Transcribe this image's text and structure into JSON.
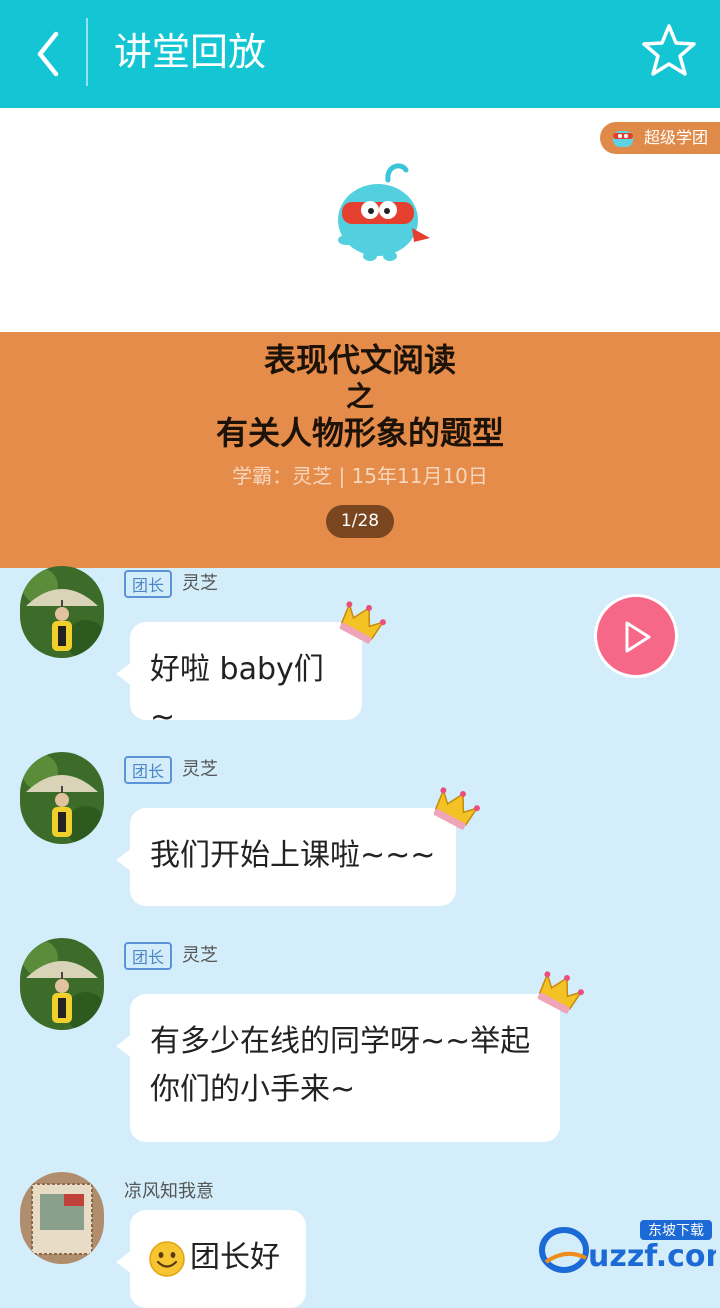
{
  "header": {
    "title": "讲堂回放"
  },
  "hero": {
    "badge": "超级学团",
    "lesson_line1": "表现代文阅读",
    "lesson_line2": "之",
    "lesson_line3": "有关人物形象的题型",
    "meta": "学霸：灵芝 | 15年11月10日",
    "page": "1/28"
  },
  "messages": [
    {
      "role": "团长",
      "name": "灵芝",
      "text": "好啦 baby们~"
    },
    {
      "role": "团长",
      "name": "灵芝",
      "text": "我们开始上课啦~~~"
    },
    {
      "role": "团长",
      "name": "灵芝",
      "text": "有多少在线的同学呀~~举起你们的小手来~"
    },
    {
      "name": "凉风知我意",
      "text": "团长好"
    }
  ],
  "watermark": {
    "text": "uzzf.com",
    "sub": "东坡下载"
  },
  "colors": {
    "header": "#14c6d4",
    "orange": "#e58c4b",
    "chat_bg": "#d3eefa",
    "play": "#f76787",
    "role_blue": "#5b93d6"
  }
}
